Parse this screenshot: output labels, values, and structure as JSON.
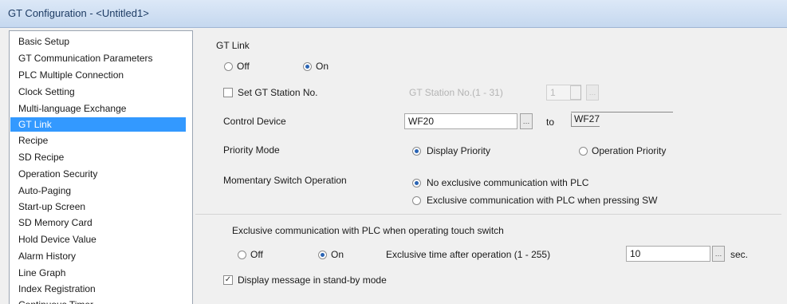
{
  "window": {
    "title": "GT Configuration - <Untitled1>"
  },
  "sidebar": {
    "items": [
      {
        "label": "Basic Setup"
      },
      {
        "label": "GT Communication Parameters"
      },
      {
        "label": "PLC Multiple Connection"
      },
      {
        "label": "Clock Setting"
      },
      {
        "label": "Multi-language Exchange"
      },
      {
        "label": "GT Link",
        "selected": true
      },
      {
        "label": "Recipe"
      },
      {
        "label": "SD Recipe"
      },
      {
        "label": "Operation Security"
      },
      {
        "label": "Auto-Paging"
      },
      {
        "label": "Start-up Screen"
      },
      {
        "label": "SD Memory Card"
      },
      {
        "label": "Hold Device Value"
      },
      {
        "label": "Alarm History"
      },
      {
        "label": "Line Graph"
      },
      {
        "label": "Index Registration"
      },
      {
        "label": "Continuous Timer"
      }
    ]
  },
  "gt_link": {
    "section_label": "GT Link",
    "off_label": "Off",
    "on_label": "On",
    "selected": "On",
    "set_station_label": "Set GT Station No.",
    "set_station_checked": false,
    "station_no_label": "GT Station No.(1 - 31)",
    "station_no_value": "1",
    "control_device_label": "Control Device",
    "control_device_from": "WF20",
    "to_label": "to",
    "control_device_to": "WF27",
    "priority_mode_label": "Priority Mode",
    "priority_display_label": "Display Priority",
    "priority_operation_label": "Operation Priority",
    "priority_selected": "Display Priority",
    "momentary_label": "Momentary Switch Operation",
    "momentary_no_exclusive_label": "No exclusive communication with PLC",
    "momentary_exclusive_label": "Exclusive communication with PLC when pressing SW",
    "momentary_selected": "No exclusive communication with PLC"
  },
  "exclusive_touch": {
    "label": "Exclusive communication with PLC when operating touch switch",
    "off_label": "Off",
    "on_label": "On",
    "selected": "On",
    "time_label": "Exclusive time after operation (1 - 255)",
    "time_value": "10",
    "unit": "sec."
  },
  "standby": {
    "label": "Display message in stand-by mode",
    "checked": true
  },
  "colors": {
    "selection": "#3399ff",
    "titlebar": "#c5d8ef"
  }
}
